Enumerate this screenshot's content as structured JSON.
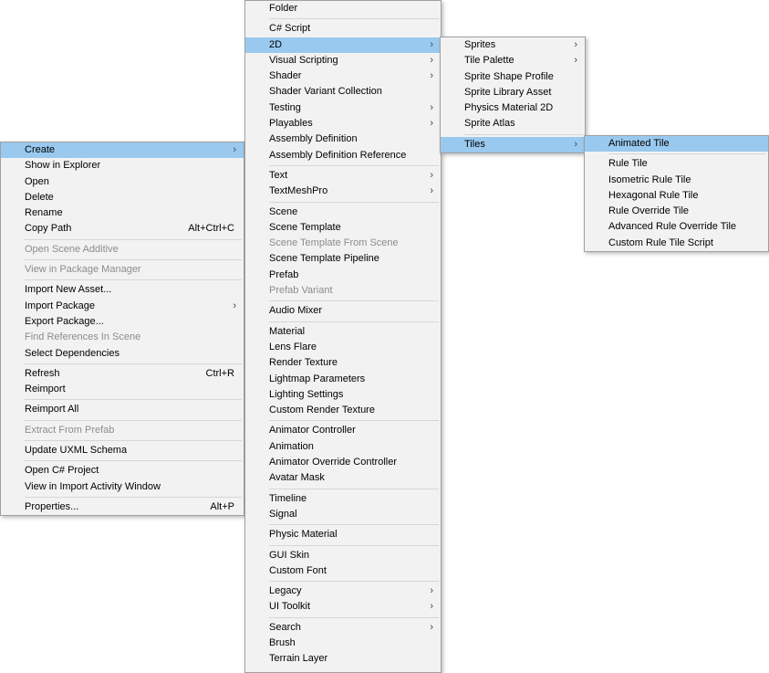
{
  "context_menu": {
    "items": [
      {
        "label": "Create",
        "arrow": "›",
        "highlighted": true
      },
      {
        "label": "Show in Explorer"
      },
      {
        "label": "Open"
      },
      {
        "label": "Delete"
      },
      {
        "label": "Rename"
      },
      {
        "label": "Copy Path",
        "shortcut": "Alt+Ctrl+C"
      },
      {
        "separator": true
      },
      {
        "label": "Open Scene Additive",
        "disabled": true
      },
      {
        "separator": true
      },
      {
        "label": "View in Package Manager",
        "disabled": true
      },
      {
        "separator": true
      },
      {
        "label": "Import New Asset..."
      },
      {
        "label": "Import Package",
        "arrow": "›"
      },
      {
        "label": "Export Package..."
      },
      {
        "label": "Find References In Scene",
        "disabled": true
      },
      {
        "label": "Select Dependencies"
      },
      {
        "separator": true
      },
      {
        "label": "Refresh",
        "shortcut": "Ctrl+R"
      },
      {
        "label": "Reimport"
      },
      {
        "separator": true
      },
      {
        "label": "Reimport All"
      },
      {
        "separator": true
      },
      {
        "label": "Extract From Prefab",
        "disabled": true
      },
      {
        "separator": true
      },
      {
        "label": "Update UXML Schema"
      },
      {
        "separator": true
      },
      {
        "label": "Open C# Project"
      },
      {
        "label": "View in Import Activity Window"
      },
      {
        "separator": true
      },
      {
        "label": "Properties...",
        "shortcut": "Alt+P"
      }
    ]
  },
  "create_menu": {
    "items": [
      {
        "label": "Folder"
      },
      {
        "separator": true
      },
      {
        "label": "C# Script"
      },
      {
        "label": "2D",
        "arrow": "›",
        "highlighted": true
      },
      {
        "label": "Visual Scripting",
        "arrow": "›"
      },
      {
        "label": "Shader",
        "arrow": "›"
      },
      {
        "label": "Shader Variant Collection"
      },
      {
        "label": "Testing",
        "arrow": "›"
      },
      {
        "label": "Playables",
        "arrow": "›"
      },
      {
        "label": "Assembly Definition"
      },
      {
        "label": "Assembly Definition Reference"
      },
      {
        "separator": true
      },
      {
        "label": "Text",
        "arrow": "›"
      },
      {
        "label": "TextMeshPro",
        "arrow": "›"
      },
      {
        "separator": true
      },
      {
        "label": "Scene"
      },
      {
        "label": "Scene Template"
      },
      {
        "label": "Scene Template From Scene",
        "disabled": true
      },
      {
        "label": "Scene Template Pipeline"
      },
      {
        "label": "Prefab"
      },
      {
        "label": "Prefab Variant",
        "disabled": true
      },
      {
        "separator": true
      },
      {
        "label": "Audio Mixer"
      },
      {
        "separator": true
      },
      {
        "label": "Material"
      },
      {
        "label": "Lens Flare"
      },
      {
        "label": "Render Texture"
      },
      {
        "label": "Lightmap Parameters"
      },
      {
        "label": "Lighting Settings"
      },
      {
        "label": "Custom Render Texture"
      },
      {
        "separator": true
      },
      {
        "label": "Animator Controller"
      },
      {
        "label": "Animation"
      },
      {
        "label": "Animator Override Controller"
      },
      {
        "label": "Avatar Mask"
      },
      {
        "separator": true
      },
      {
        "label": "Timeline"
      },
      {
        "label": "Signal"
      },
      {
        "separator": true
      },
      {
        "label": "Physic Material"
      },
      {
        "separator": true
      },
      {
        "label": "GUI Skin"
      },
      {
        "label": "Custom Font"
      },
      {
        "separator": true
      },
      {
        "label": "Legacy",
        "arrow": "›"
      },
      {
        "label": "UI Toolkit",
        "arrow": "›"
      },
      {
        "separator": true
      },
      {
        "label": "Search",
        "arrow": "›"
      },
      {
        "label": "Brush"
      },
      {
        "label": "Terrain Layer"
      }
    ]
  },
  "menu_2d": {
    "items": [
      {
        "label": "Sprites",
        "arrow": "›"
      },
      {
        "label": "Tile Palette",
        "arrow": "›"
      },
      {
        "label": "Sprite Shape Profile"
      },
      {
        "label": "Sprite Library Asset"
      },
      {
        "label": "Physics Material 2D"
      },
      {
        "label": "Sprite Atlas"
      },
      {
        "separator": true
      },
      {
        "label": "Tiles",
        "arrow": "›",
        "highlighted": true
      }
    ]
  },
  "tiles_menu": {
    "items": [
      {
        "label": "Animated Tile",
        "highlighted": true
      },
      {
        "separator": true
      },
      {
        "label": "Rule Tile"
      },
      {
        "label": "Isometric Rule Tile"
      },
      {
        "label": "Hexagonal Rule Tile"
      },
      {
        "label": "Rule Override Tile"
      },
      {
        "label": "Advanced Rule Override Tile"
      },
      {
        "label": "Custom Rule Tile Script"
      }
    ]
  },
  "colors": {
    "menu_background": "#f2f2f2",
    "highlight": "#99c9ef",
    "disabled_text": "#8c8c8c",
    "separator": "#d6d6d6"
  }
}
